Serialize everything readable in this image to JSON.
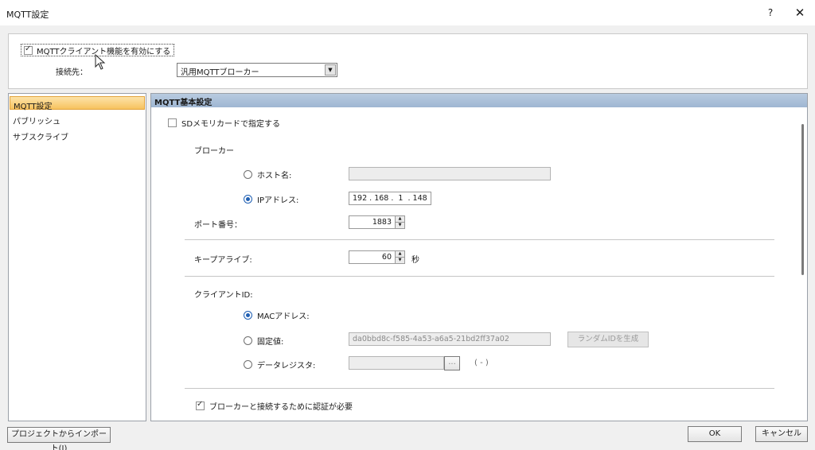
{
  "window": {
    "title": "MQTT設定",
    "help_label": "?",
    "close_label": "✕"
  },
  "top": {
    "enable_label": "MQTTクライアント機能を有効にする",
    "enable_checked": true,
    "connection_label": "接続先：",
    "connection_value": "汎用MQTTブローカー"
  },
  "nav": {
    "items": [
      {
        "label": "MQTT設定",
        "selected": true
      },
      {
        "label": "パブリッシュ",
        "selected": false
      },
      {
        "label": "サブスクライブ",
        "selected": false
      }
    ]
  },
  "main": {
    "header": "MQTT基本設定",
    "sd_label": "SDメモリカードで指定する",
    "broker_label": "ブローカー",
    "hostname_label": "ホスト名:",
    "hostname_value": "",
    "ip_label": "IPアドレス:",
    "ip_value": "192 . 168 .  1  . 148",
    "port_label": "ポート番号：",
    "port_value": "1883",
    "keepalive_label": "キープアライブ:",
    "keepalive_value": "60",
    "keepalive_unit": "秒",
    "client_id_label": "クライアントID:",
    "mac_label": "MACアドレス:",
    "fixed_label": "固定値:",
    "fixed_value": "da0bbd8c-f585-4a53-a6a5-21bd2ff37a02",
    "random_button": "ランダムIDを生成",
    "datareg_label": "データレジスタ:",
    "datareg_browse": "...",
    "datareg_paren": "( - )",
    "auth_label": "ブローカーと接続するために認証が必要",
    "auth_checked": true
  },
  "footer": {
    "import_label": "プロジェクトからインポート(I)",
    "ok_label": "OK",
    "cancel_label": "キャンセル"
  },
  "colors": {
    "selected_nav": "#f7c35f",
    "header_bg": "#a8bed8",
    "radio_on": "#1f5fb3"
  }
}
